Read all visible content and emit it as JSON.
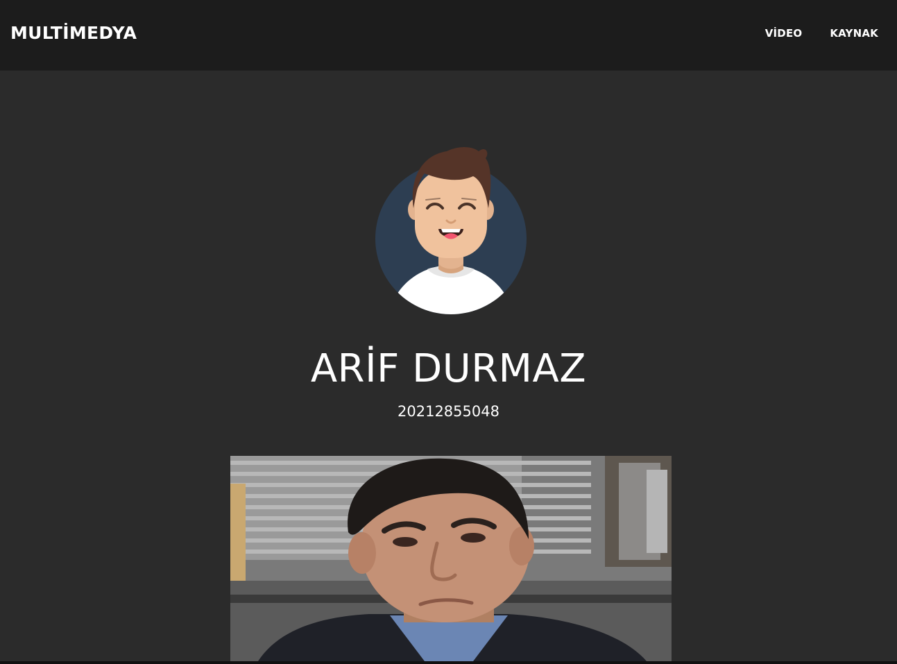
{
  "navbar": {
    "brand": "MULTİMEDYA",
    "links": [
      {
        "label": "VİDEO"
      },
      {
        "label": "KAYNAK"
      }
    ]
  },
  "profile": {
    "name": "ARİF DURMAZ",
    "student_id": "20212855048",
    "avatar_icon": "smiling-man-avatar-icon"
  },
  "colors": {
    "page_background": "#2b2b2b",
    "navbar_background": "#1c1c1c",
    "text": "#ffffff",
    "avatar_circle": "#2d3e52"
  }
}
